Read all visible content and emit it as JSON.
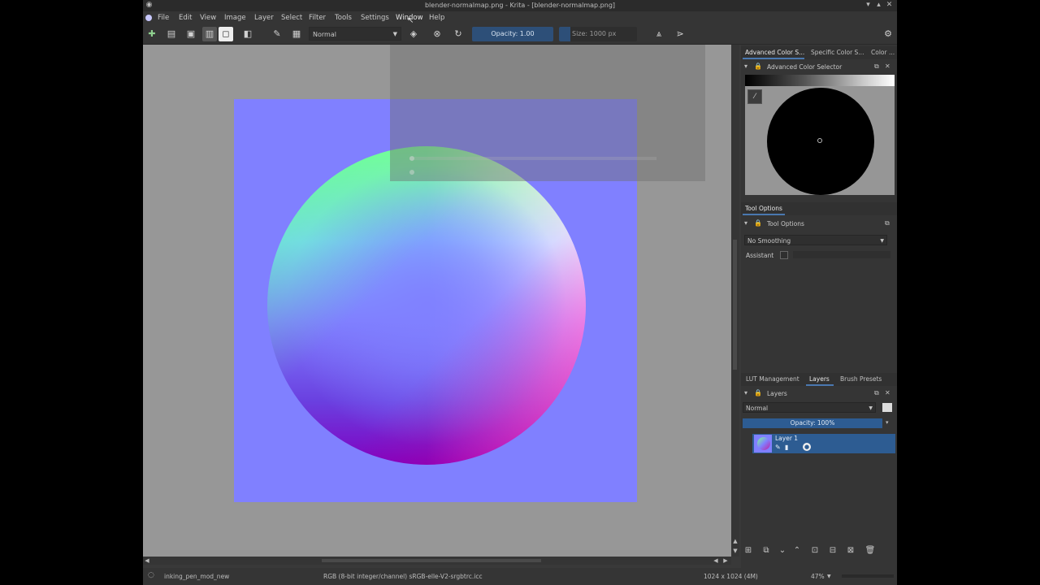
{
  "window": {
    "title": "blender-normalmap.png - Krita - [blender-normalmap.png]",
    "controls": [
      "minimize-icon",
      "maximize-icon",
      "close-icon"
    ]
  },
  "menubar": {
    "items": [
      "File",
      "Edit",
      "View",
      "Image",
      "Layer",
      "Select",
      "Filter",
      "Tools",
      "Settings",
      "Window",
      "Help"
    ],
    "active": "Window"
  },
  "toolbar": {
    "blend_mode": "Normal",
    "opacity": "Opacity: 1.00",
    "size": "Size: 1000 px"
  },
  "status": {
    "brush": "inking_pen_mod_new",
    "color_space": "RGB (8-bit integer/channel) sRGB-elle-V2-srgbtrc.icc",
    "dimensions": "1024 x 1024 (4M)",
    "zoom": "47%"
  },
  "dock": {
    "top_tabs": [
      "Advanced Color S...",
      "Specific Color S...",
      "Color ..."
    ],
    "color_selector_title": "Advanced Color Selector",
    "tool_options_tab": "Tool Options",
    "tool_options_title": "Tool Options",
    "smoothing": "No Smoothing",
    "assistant_label": "Assistant",
    "bottom_tabs": [
      "LUT Management",
      "Layers",
      "Brush Presets"
    ],
    "layers_title": "Layers",
    "layers_blend": "Normal",
    "layers_opacity": "Opacity: 100%",
    "layer_name": "Layer 1"
  },
  "colors": {
    "accent": "#2d5c92",
    "canvas_bg": "#979797",
    "normal_map_bg": "#8080ff"
  }
}
